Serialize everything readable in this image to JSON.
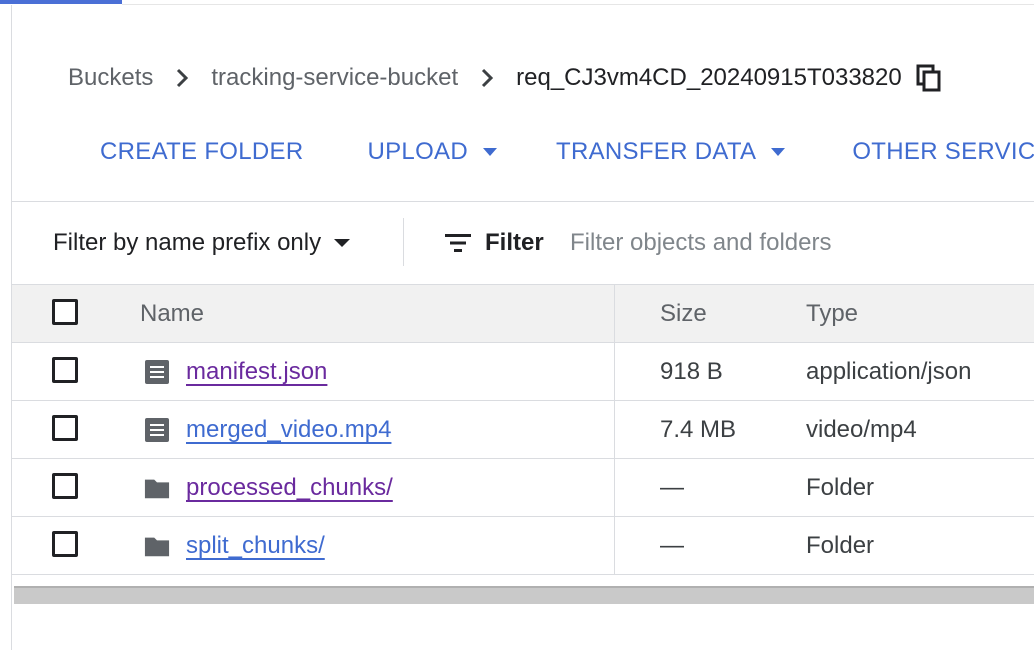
{
  "breadcrumb": {
    "items": [
      "Buckets",
      "tracking-service-bucket"
    ],
    "current": "req_CJ3vm4CD_20240915T033820"
  },
  "toolbar": {
    "create_folder": "CREATE FOLDER",
    "upload": "UPLOAD",
    "transfer_data": "TRANSFER DATA",
    "other_services": "OTHER SERVIC"
  },
  "filter": {
    "mode": "Filter by name prefix only",
    "label": "Filter",
    "placeholder": "Filter objects and folders"
  },
  "table": {
    "columns": {
      "name": "Name",
      "size": "Size",
      "type": "Type"
    },
    "rows": [
      {
        "name": "manifest.json",
        "size": "918 B",
        "type": "application/json",
        "icon": "file-icon",
        "visited": true
      },
      {
        "name": "merged_video.mp4",
        "size": "7.4 MB",
        "type": "video/mp4",
        "icon": "file-icon",
        "visited": false
      },
      {
        "name": "processed_chunks/",
        "size": "—",
        "type": "Folder",
        "icon": "folder-icon",
        "visited": true
      },
      {
        "name": "split_chunks/",
        "size": "—",
        "type": "Folder",
        "icon": "folder-icon",
        "visited": false
      }
    ]
  },
  "colors": {
    "link": "#3f6bd0",
    "visited_link": "#6a2a9e",
    "header_bg": "#f1f1f1"
  }
}
